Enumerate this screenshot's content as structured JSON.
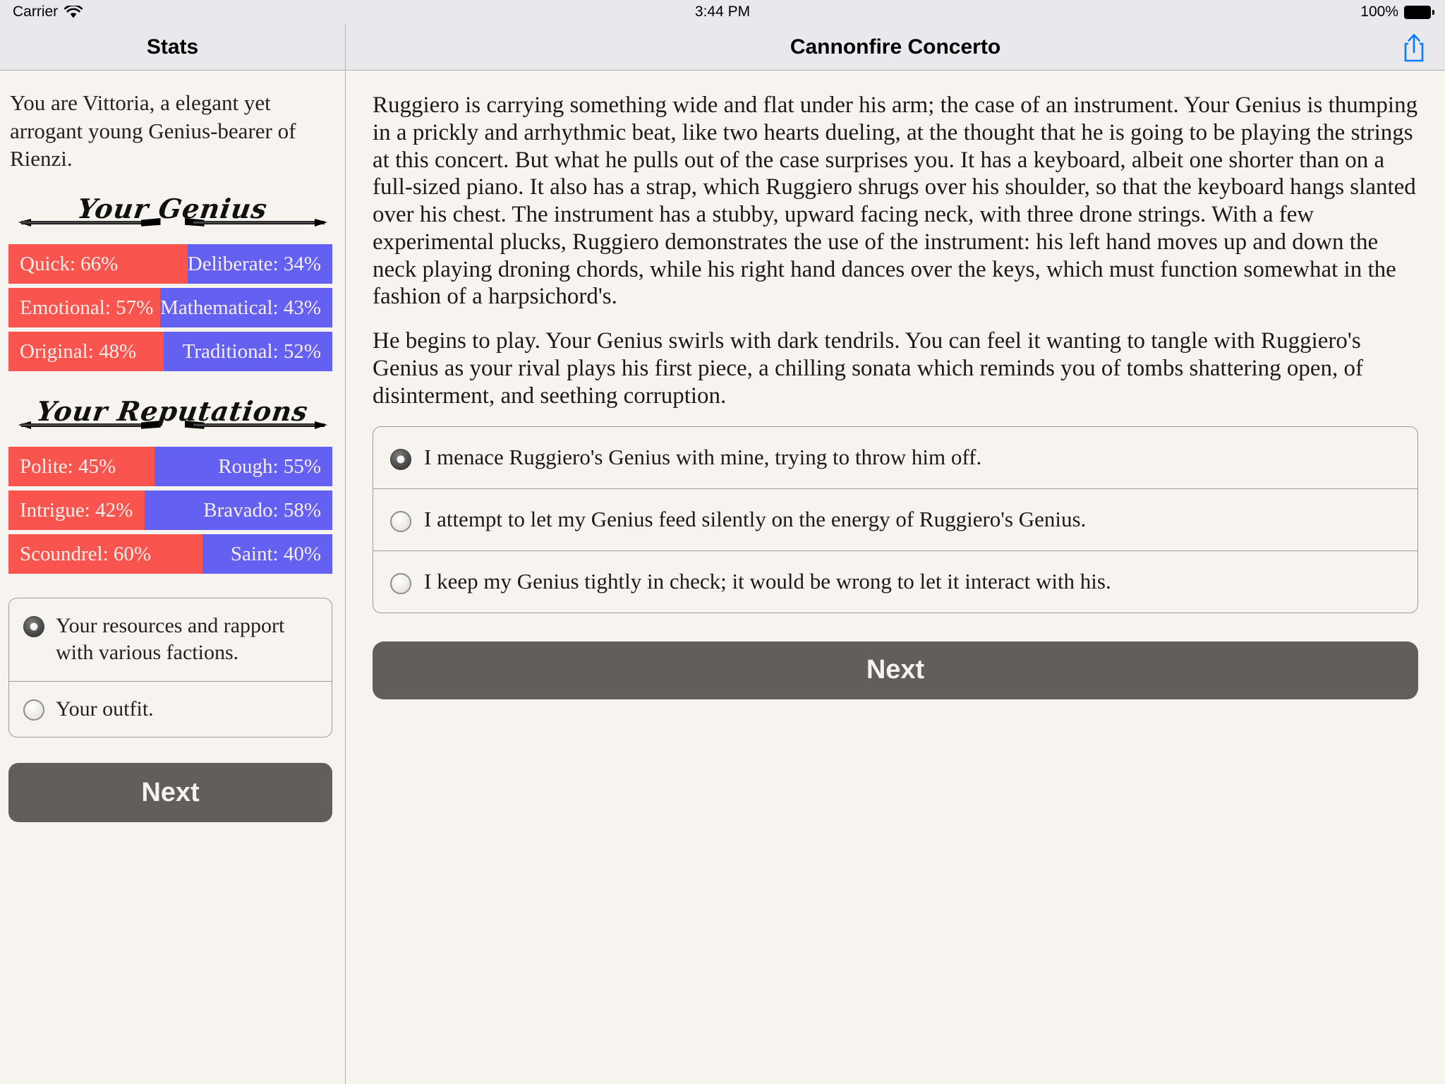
{
  "status_bar": {
    "carrier": "Carrier",
    "wifi_icon": "wifi-icon",
    "time": "3:44 PM",
    "battery_percent": "100%",
    "battery_icon": "battery-full-icon"
  },
  "nav": {
    "left_title": "Stats",
    "right_title": "Cannonfire Concerto",
    "share_icon": "share-icon"
  },
  "colors": {
    "bar_left": "#F9554E",
    "bar_right": "#6360F2",
    "bar_text": "#F7EFEC",
    "background": "#F7F4F0",
    "chrome": "#E9E9ED",
    "button": "#615E5B",
    "accent_blue": "#0A7BFF"
  },
  "stats_pane": {
    "intro": "You are Vittoria, a elegant yet arrogant young Genius-bearer of Rienzi.",
    "sections": [
      {
        "heading": "Your Genius",
        "bars": [
          {
            "left_label": "Quick: 66%",
            "left_pct": 66,
            "right_label": "Deliberate: 34%",
            "right_pct": 34
          },
          {
            "left_label": "Emotional: 57%",
            "left_pct": 57,
            "right_label": "Mathematical: 43%",
            "right_pct": 43
          },
          {
            "left_label": "Original: 48%",
            "left_pct": 48,
            "right_label": "Traditional: 52%",
            "right_pct": 52
          }
        ]
      },
      {
        "heading": "Your Reputations",
        "bars": [
          {
            "left_label": "Polite: 45%",
            "left_pct": 45,
            "right_label": "Rough: 55%",
            "right_pct": 55
          },
          {
            "left_label": "Intrigue: 42%",
            "left_pct": 42,
            "right_label": "Bravado: 58%",
            "right_pct": 58
          },
          {
            "left_label": "Scoundrel: 60%",
            "left_pct": 60,
            "right_label": "Saint: 40%",
            "right_pct": 40
          }
        ]
      }
    ],
    "options": [
      {
        "label": "Your resources and rapport with various factions.",
        "selected": true
      },
      {
        "label": "Your outfit.",
        "selected": false
      }
    ],
    "next_label": "Next"
  },
  "story_pane": {
    "paragraphs": [
      "Ruggiero is carrying something wide and flat under his arm; the case of an instrument. Your Genius is thumping in a prickly and arrhythmic beat, like two hearts dueling, at the thought that he is going to be playing the strings at this concert. But what he pulls out of the case surprises you. It has a keyboard, albeit one shorter than on a full-sized piano. It also has a strap, which Ruggiero shrugs over his shoulder, so that the keyboard hangs slanted over his chest. The instrument has a stubby, upward facing neck, with three drone strings. With a few experimental plucks, Ruggiero demonstrates the use of the instrument: his left hand moves up and down the neck playing droning chords, while his right hand dances over the keys, which must function somewhat in the fashion of a harpsichord's.",
      "He begins to play. Your Genius swirls with dark tendrils. You can feel it wanting to tangle with Ruggiero's Genius as your rival plays his first piece, a chilling sonata which reminds you of tombs shattering open, of disinterment, and seething corruption."
    ],
    "choices": [
      {
        "label": "I menace Ruggiero's Genius with mine, trying to throw him off.",
        "selected": true
      },
      {
        "label": "I attempt to let my Genius feed silently on the energy of Ruggiero's Genius.",
        "selected": false
      },
      {
        "label": "I keep my Genius tightly in check; it would be wrong to let it interact with his.",
        "selected": false
      }
    ],
    "next_label": "Next"
  }
}
